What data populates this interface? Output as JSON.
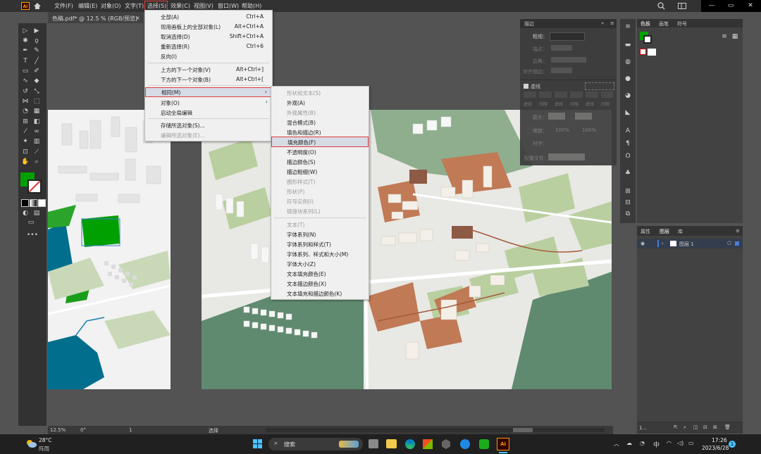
{
  "app": {
    "logo": "Ai",
    "home_icon": "home-icon"
  },
  "menubar": {
    "items": [
      "文件(F)",
      "编辑(E)",
      "对象(O)",
      "文字(T)",
      "选择(S)",
      "效果(C)",
      "视图(V)",
      "窗口(W)",
      "帮助(H)"
    ],
    "active": "选择(S)",
    "highlight_color": "#e23c3c"
  },
  "document_tab": {
    "title": "色稿.pdf* @ 12.5 % (RGB/预览)",
    "close": "×"
  },
  "select_menu": {
    "items": [
      {
        "label": "全部(A)",
        "shortcut": "Ctrl+A",
        "disabled": false
      },
      {
        "label": "现用画板上的全部对象(L)",
        "shortcut": "Alt+Ctrl+A",
        "disabled": false
      },
      {
        "label": "取消选择(D)",
        "shortcut": "Shift+Ctrl+A",
        "disabled": false
      },
      {
        "label": "重新选择(R)",
        "shortcut": "Ctrl+6",
        "disabled": false
      },
      {
        "label": "反向(I)",
        "shortcut": "",
        "disabled": false
      },
      {
        "label": "上方的下一个对象(V)",
        "shortcut": "Alt+Ctrl+]",
        "disabled": false
      },
      {
        "label": "下方的下一个对象(B)",
        "shortcut": "Alt+Ctrl+[",
        "disabled": false
      },
      {
        "label": "相同(M)",
        "shortcut": "",
        "disabled": false,
        "submenu": true
      },
      {
        "label": "对象(O)",
        "shortcut": "",
        "disabled": false,
        "submenu": true
      },
      {
        "label": "启动全局编辑",
        "shortcut": "",
        "disabled": false
      },
      {
        "label": "存储所选对象(S)...",
        "shortcut": "",
        "disabled": false
      },
      {
        "label": "编辑所选对象(E)...",
        "shortcut": "",
        "disabled": true
      }
    ]
  },
  "same_submenu": {
    "items": [
      {
        "label": "形状和文本(S)",
        "disabled": true
      },
      {
        "label": "外观(A)",
        "disabled": false
      },
      {
        "label": "外观属性(B)",
        "disabled": true
      },
      {
        "label": "混合模式(B)",
        "disabled": false
      },
      {
        "label": "填色和描边(R)",
        "disabled": false
      },
      {
        "label": "填充颜色(F)",
        "disabled": false,
        "highlighted": true
      },
      {
        "label": "不透明度(O)",
        "disabled": false
      },
      {
        "label": "描边颜色(S)",
        "disabled": false
      },
      {
        "label": "描边粗细(W)",
        "disabled": false
      },
      {
        "label": "图形样式(T)",
        "disabled": true
      },
      {
        "label": "形状(P)",
        "disabled": true
      },
      {
        "label": "符号实例(I)",
        "disabled": true
      },
      {
        "label": "链接块系列(L)",
        "disabled": true
      },
      {
        "label": "文本(T)",
        "disabled": true
      },
      {
        "label": "字体系列(N)",
        "disabled": false
      },
      {
        "label": "字体系列和样式(T)",
        "disabled": false
      },
      {
        "label": "字体系列、样式和大小(M)",
        "disabled": false
      },
      {
        "label": "字体大小(Z)",
        "disabled": false
      },
      {
        "label": "文本填充颜色(E)",
        "disabled": false
      },
      {
        "label": "文本描边颜色(X)",
        "disabled": false
      },
      {
        "label": "文本填充和描边颜色(K)",
        "disabled": false
      }
    ]
  },
  "stroke_panel": {
    "title": "描边",
    "weight_label": "粗细：",
    "cap_label": "端点：",
    "corner_label": "边角：",
    "align_label": "对齐描边：",
    "dashed_label": "虚线",
    "dash_labels": [
      "虚线",
      "间隙",
      "虚线",
      "间隙",
      "虚线",
      "间隙"
    ],
    "arrow_label": "箭头：",
    "scale_label": "缩放：",
    "scale_values": [
      "100%",
      "100%"
    ],
    "align_label2": "对齐：",
    "profile_label": "配置文件："
  },
  "swatch_panel": {
    "tabs": [
      "色板",
      "画笔",
      "符号"
    ]
  },
  "layers_panel": {
    "tabs": [
      "属性",
      "图层",
      "库"
    ],
    "layer_name": "图层 1",
    "footer": "1..."
  },
  "statusbar": {
    "zoom": "12.5%",
    "angle": "0°",
    "artboard": "1",
    "mode": "选择"
  },
  "taskbar": {
    "weather_temp": "28°C",
    "weather_desc": "阵雨",
    "search": "搜索",
    "time": "17:26",
    "date": "2023/6/28",
    "ime": "中",
    "notification_count": "1"
  },
  "colors": {
    "menu_bg": "#f0f0f0",
    "app_bg": "#535353",
    "panel_bg": "#424242",
    "fill_swatch": "#00a000"
  }
}
